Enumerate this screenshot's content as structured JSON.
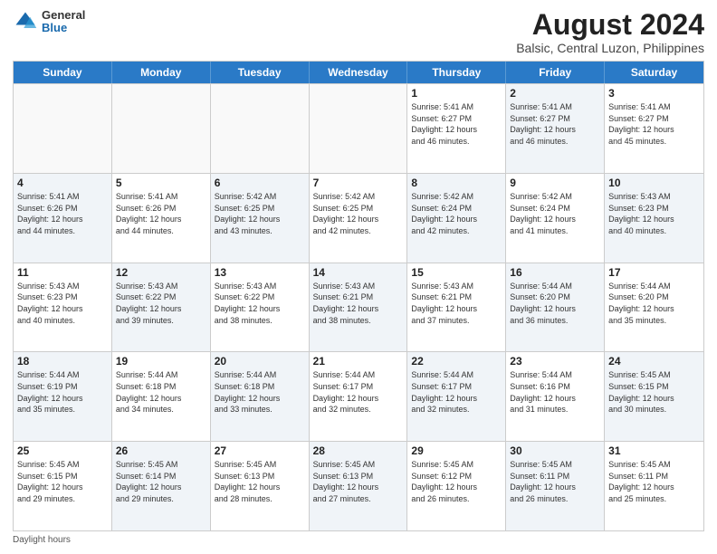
{
  "logo": {
    "general": "General",
    "blue": "Blue"
  },
  "title": "August 2024",
  "subtitle": "Balsic, Central Luzon, Philippines",
  "footer": "Daylight hours",
  "weekdays": [
    "Sunday",
    "Monday",
    "Tuesday",
    "Wednesday",
    "Thursday",
    "Friday",
    "Saturday"
  ],
  "weeks": [
    [
      {
        "day": "",
        "info": "",
        "shaded": false,
        "empty": true
      },
      {
        "day": "",
        "info": "",
        "shaded": false,
        "empty": true
      },
      {
        "day": "",
        "info": "",
        "shaded": false,
        "empty": true
      },
      {
        "day": "",
        "info": "",
        "shaded": false,
        "empty": true
      },
      {
        "day": "1",
        "info": "Sunrise: 5:41 AM\nSunset: 6:27 PM\nDaylight: 12 hours\nand 46 minutes.",
        "shaded": false,
        "empty": false
      },
      {
        "day": "2",
        "info": "Sunrise: 5:41 AM\nSunset: 6:27 PM\nDaylight: 12 hours\nand 46 minutes.",
        "shaded": true,
        "empty": false
      },
      {
        "day": "3",
        "info": "Sunrise: 5:41 AM\nSunset: 6:27 PM\nDaylight: 12 hours\nand 45 minutes.",
        "shaded": false,
        "empty": false
      }
    ],
    [
      {
        "day": "4",
        "info": "Sunrise: 5:41 AM\nSunset: 6:26 PM\nDaylight: 12 hours\nand 44 minutes.",
        "shaded": true,
        "empty": false
      },
      {
        "day": "5",
        "info": "Sunrise: 5:41 AM\nSunset: 6:26 PM\nDaylight: 12 hours\nand 44 minutes.",
        "shaded": false,
        "empty": false
      },
      {
        "day": "6",
        "info": "Sunrise: 5:42 AM\nSunset: 6:25 PM\nDaylight: 12 hours\nand 43 minutes.",
        "shaded": true,
        "empty": false
      },
      {
        "day": "7",
        "info": "Sunrise: 5:42 AM\nSunset: 6:25 PM\nDaylight: 12 hours\nand 42 minutes.",
        "shaded": false,
        "empty": false
      },
      {
        "day": "8",
        "info": "Sunrise: 5:42 AM\nSunset: 6:24 PM\nDaylight: 12 hours\nand 42 minutes.",
        "shaded": true,
        "empty": false
      },
      {
        "day": "9",
        "info": "Sunrise: 5:42 AM\nSunset: 6:24 PM\nDaylight: 12 hours\nand 41 minutes.",
        "shaded": false,
        "empty": false
      },
      {
        "day": "10",
        "info": "Sunrise: 5:43 AM\nSunset: 6:23 PM\nDaylight: 12 hours\nand 40 minutes.",
        "shaded": true,
        "empty": false
      }
    ],
    [
      {
        "day": "11",
        "info": "Sunrise: 5:43 AM\nSunset: 6:23 PM\nDaylight: 12 hours\nand 40 minutes.",
        "shaded": false,
        "empty": false
      },
      {
        "day": "12",
        "info": "Sunrise: 5:43 AM\nSunset: 6:22 PM\nDaylight: 12 hours\nand 39 minutes.",
        "shaded": true,
        "empty": false
      },
      {
        "day": "13",
        "info": "Sunrise: 5:43 AM\nSunset: 6:22 PM\nDaylight: 12 hours\nand 38 minutes.",
        "shaded": false,
        "empty": false
      },
      {
        "day": "14",
        "info": "Sunrise: 5:43 AM\nSunset: 6:21 PM\nDaylight: 12 hours\nand 38 minutes.",
        "shaded": true,
        "empty": false
      },
      {
        "day": "15",
        "info": "Sunrise: 5:43 AM\nSunset: 6:21 PM\nDaylight: 12 hours\nand 37 minutes.",
        "shaded": false,
        "empty": false
      },
      {
        "day": "16",
        "info": "Sunrise: 5:44 AM\nSunset: 6:20 PM\nDaylight: 12 hours\nand 36 minutes.",
        "shaded": true,
        "empty": false
      },
      {
        "day": "17",
        "info": "Sunrise: 5:44 AM\nSunset: 6:20 PM\nDaylight: 12 hours\nand 35 minutes.",
        "shaded": false,
        "empty": false
      }
    ],
    [
      {
        "day": "18",
        "info": "Sunrise: 5:44 AM\nSunset: 6:19 PM\nDaylight: 12 hours\nand 35 minutes.",
        "shaded": true,
        "empty": false
      },
      {
        "day": "19",
        "info": "Sunrise: 5:44 AM\nSunset: 6:18 PM\nDaylight: 12 hours\nand 34 minutes.",
        "shaded": false,
        "empty": false
      },
      {
        "day": "20",
        "info": "Sunrise: 5:44 AM\nSunset: 6:18 PM\nDaylight: 12 hours\nand 33 minutes.",
        "shaded": true,
        "empty": false
      },
      {
        "day": "21",
        "info": "Sunrise: 5:44 AM\nSunset: 6:17 PM\nDaylight: 12 hours\nand 32 minutes.",
        "shaded": false,
        "empty": false
      },
      {
        "day": "22",
        "info": "Sunrise: 5:44 AM\nSunset: 6:17 PM\nDaylight: 12 hours\nand 32 minutes.",
        "shaded": true,
        "empty": false
      },
      {
        "day": "23",
        "info": "Sunrise: 5:44 AM\nSunset: 6:16 PM\nDaylight: 12 hours\nand 31 minutes.",
        "shaded": false,
        "empty": false
      },
      {
        "day": "24",
        "info": "Sunrise: 5:45 AM\nSunset: 6:15 PM\nDaylight: 12 hours\nand 30 minutes.",
        "shaded": true,
        "empty": false
      }
    ],
    [
      {
        "day": "25",
        "info": "Sunrise: 5:45 AM\nSunset: 6:15 PM\nDaylight: 12 hours\nand 29 minutes.",
        "shaded": false,
        "empty": false
      },
      {
        "day": "26",
        "info": "Sunrise: 5:45 AM\nSunset: 6:14 PM\nDaylight: 12 hours\nand 29 minutes.",
        "shaded": true,
        "empty": false
      },
      {
        "day": "27",
        "info": "Sunrise: 5:45 AM\nSunset: 6:13 PM\nDaylight: 12 hours\nand 28 minutes.",
        "shaded": false,
        "empty": false
      },
      {
        "day": "28",
        "info": "Sunrise: 5:45 AM\nSunset: 6:13 PM\nDaylight: 12 hours\nand 27 minutes.",
        "shaded": true,
        "empty": false
      },
      {
        "day": "29",
        "info": "Sunrise: 5:45 AM\nSunset: 6:12 PM\nDaylight: 12 hours\nand 26 minutes.",
        "shaded": false,
        "empty": false
      },
      {
        "day": "30",
        "info": "Sunrise: 5:45 AM\nSunset: 6:11 PM\nDaylight: 12 hours\nand 26 minutes.",
        "shaded": true,
        "empty": false
      },
      {
        "day": "31",
        "info": "Sunrise: 5:45 AM\nSunset: 6:11 PM\nDaylight: 12 hours\nand 25 minutes.",
        "shaded": false,
        "empty": false
      }
    ]
  ]
}
